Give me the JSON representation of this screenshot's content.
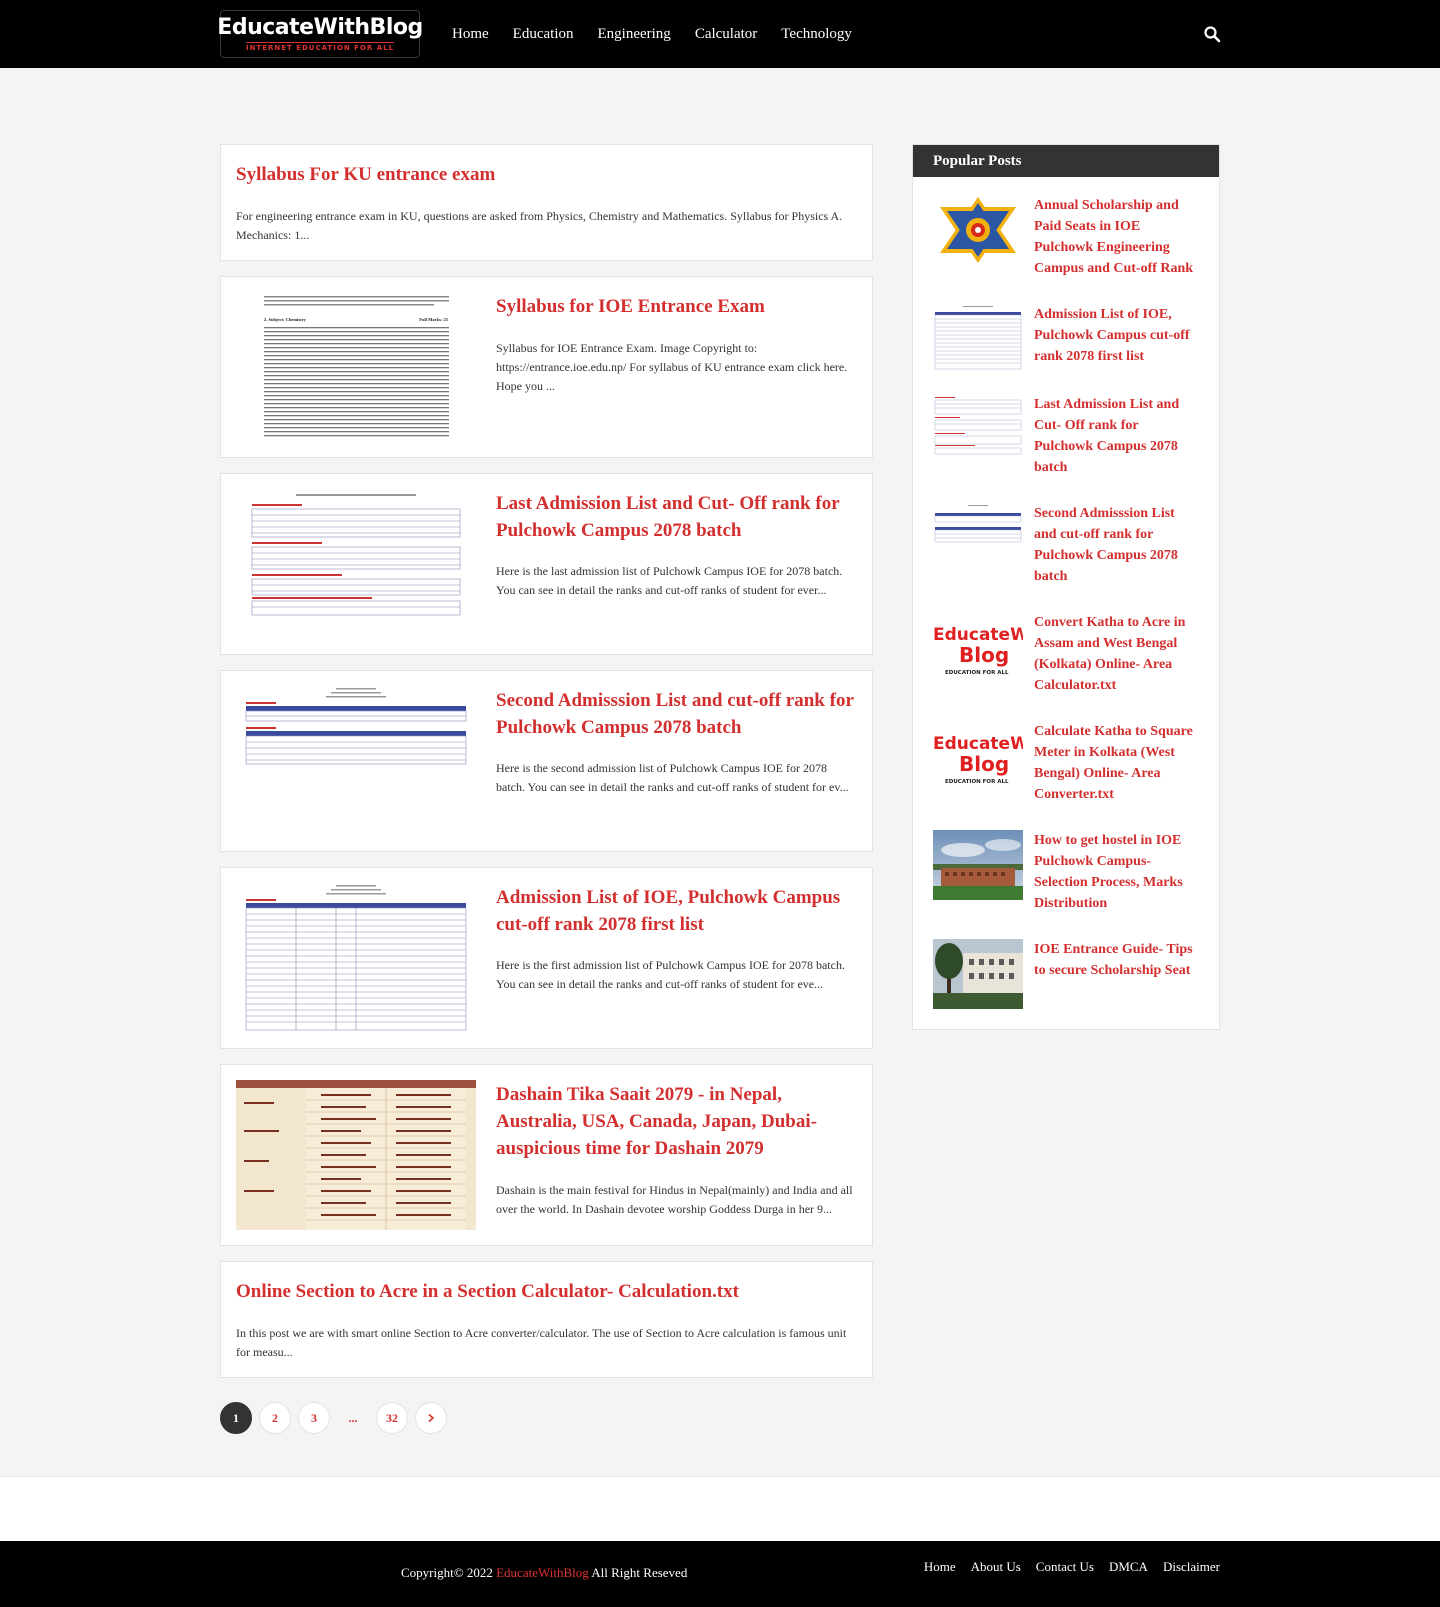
{
  "header": {
    "logo_text": "EducateWithBlog",
    "logo_tagline": "INTERNET EDUCATION FOR ALL",
    "nav": [
      "Home",
      "Education",
      "Engineering",
      "Calculator",
      "Technology"
    ],
    "search_icon": "search-icon"
  },
  "posts": [
    {
      "title": "Syllabus For KU entrance exam",
      "excerpt": "For engineering entrance exam in KU, questions are asked from Physics, Chemistry and Mathematics.   Syllabus for Physics A. Mechanics: 1..."
    },
    {
      "title": "Syllabus for IOE Entrance Exam",
      "excerpt": "Syllabus for IOE Entrance Exam. Image Copyright to: https://entrance.ioe.edu.np/ For syllabus of KU entrance exam click here. Hope you ...",
      "thumb_heading_left": "2. Subject: Chemistry",
      "thumb_heading_right": "Full Marks: 25"
    },
    {
      "title": "Last Admission List and Cut- Off rank for Pulchowk Campus 2078 batch",
      "excerpt": "Here is the last admission list of Pulchowk Campus IOE for 2078 batch. You can see in detail the ranks and cut-off ranks of student for ever..."
    },
    {
      "title": "Second Admisssion List and cut-off rank for Pulchowk Campus 2078 batch",
      "excerpt": "Here is the second admission list of Pulchowk Campus IOE for 2078 batch. You can see in detail the ranks and cut-off ranks of student for ev..."
    },
    {
      "title": "Admission List of IOE, Pulchowk Campus cut-off rank 2078 first list",
      "excerpt": "Here is the first admission list of Pulchowk Campus IOE for 2078 batch. You can see in detail the ranks and cut-off ranks of student for eve..."
    },
    {
      "title": "Dashain Tika Saait 2079 - in Nepal, Australia, USA, Canada, Japan, Dubai- auspicious time for Dashain 2079",
      "excerpt": "Dashain is the main festival for Hindus in Nepal(mainly) and India and all over the world. In Dashain devotee worship Goddess Durga in her 9..."
    },
    {
      "title": "Online Section to Acre in a Section Calculator- Calculation.txt",
      "excerpt": "In this post we are with smart online Section to Acre converter/calculator. The use of Section to Acre calculation is famous unit for measu..."
    }
  ],
  "pagination": {
    "pages": [
      "1",
      "2",
      "3"
    ],
    "dots": "...",
    "last": "32",
    "current": "1",
    "next_icon": "chevron-right-icon"
  },
  "sidebar": {
    "heading": "Popular Posts",
    "items": [
      {
        "title": "Annual Scholarship and Paid Seats in IOE Pulchowk Engineering Campus and Cut-off Rank",
        "thumb": "ioe-logo"
      },
      {
        "title": "Admission List of IOE, Pulchowk Campus cut-off rank 2078 first list",
        "thumb": "table"
      },
      {
        "title": "Last Admission List and Cut- Off rank for Pulchowk Campus 2078 batch",
        "thumb": "table"
      },
      {
        "title": "Second Admisssion List and cut-off rank for Pulchowk Campus 2078 batch",
        "thumb": "table"
      },
      {
        "title": "Convert Katha to Acre in Assam and West Bengal (Kolkata) Online- Area Calculator.txt",
        "thumb": "blog-logo",
        "thumb_line1": "EducateWith",
        "thumb_line2": "Blog",
        "thumb_line3": "EDUCATION FOR ALL"
      },
      {
        "title": "Calculate Katha to Square Meter in Kolkata (West Bengal) Online- Area Converter.txt",
        "thumb": "blog-logo",
        "thumb_line1": "EducateWith",
        "thumb_line2": "Blog",
        "thumb_line3": "EDUCATION FOR ALL"
      },
      {
        "title": "How to get hostel in IOE Pulchowk Campus- Selection Process, Marks Distribution",
        "thumb": "photo-campus"
      },
      {
        "title": "IOE Entrance Guide- Tips to secure Scholarship Seat",
        "thumb": "photo-building"
      }
    ]
  },
  "footer": {
    "copyright_prefix": "Copyright© 2022 ",
    "brand": "EducateWithBlog",
    "copyright_suffix": " All Right Reseved",
    "links": [
      "Home",
      "About Us",
      "Contact Us",
      "DMCA",
      "Disclaimer"
    ]
  },
  "colors": {
    "accent": "#d32f2f",
    "header_bg": "#000000",
    "page_bg": "#f4f4f4"
  }
}
